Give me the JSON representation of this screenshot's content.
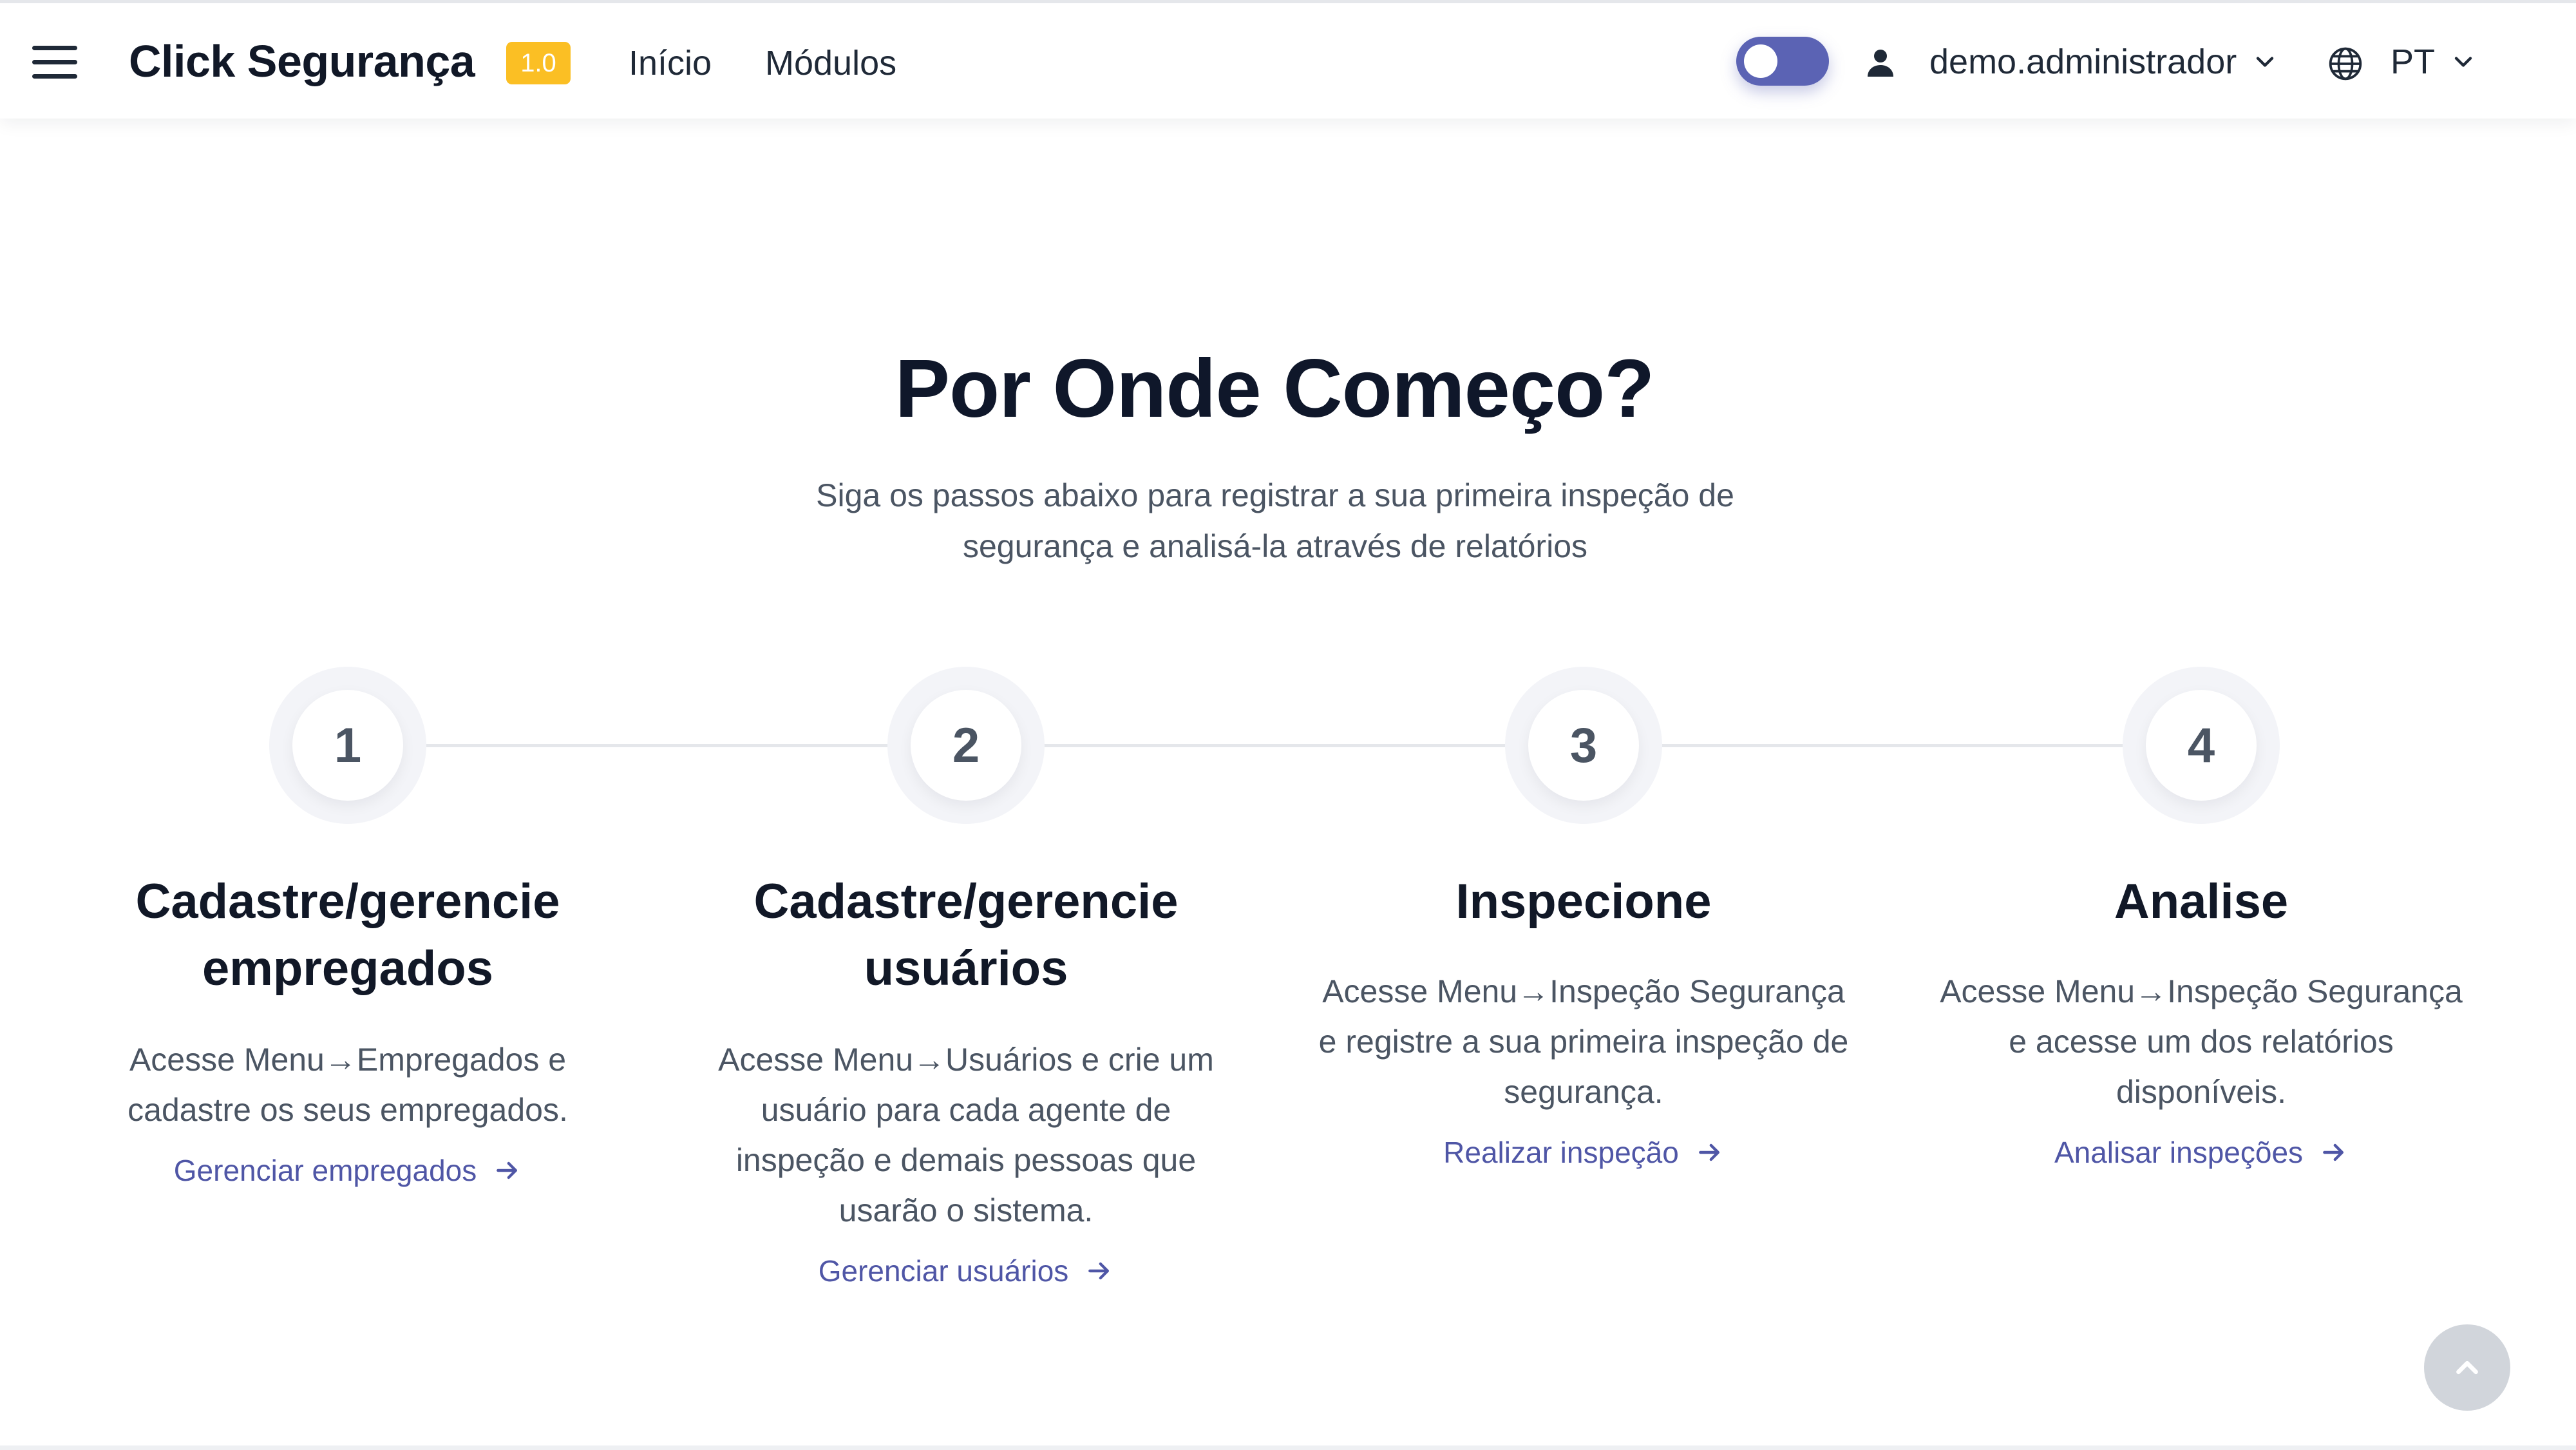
{
  "header": {
    "brand": "Click Segurança",
    "version": "1.0",
    "nav": {
      "inicio": "Início",
      "modulos": "Módulos"
    },
    "toggle_state": "off",
    "user": "demo.administrador",
    "language": "PT",
    "icons": {
      "menu": "hamburger-icon",
      "user": "user-icon",
      "language": "globe-icon",
      "dropdown": "chevron-down-icon"
    }
  },
  "hero": {
    "title": "Por Onde Começo?",
    "subtitle": "Siga os passos abaixo para registrar a sua primeira inspeção de segurança e analisá-la através de relatórios"
  },
  "steps": [
    {
      "number": "1",
      "title": "Cadastre/gerencie empregados",
      "description": "Acesse Menu→Empregados e cadastre os seus empregados.",
      "link": "Gerenciar empregados"
    },
    {
      "number": "2",
      "title": "Cadastre/gerencie usuários",
      "description": "Acesse Menu→Usuários e crie um usuário para cada agente de inspeção e demais pessoas que usarão o sistema.",
      "link": "Gerenciar usuários"
    },
    {
      "number": "3",
      "title": "Inspecione",
      "description": "Acesse Menu→Inspeção Segurança e registre a sua primeira inspeção de segurança.",
      "link": "Realizar inspeção"
    },
    {
      "number": "4",
      "title": "Analise",
      "description": "Acesse Menu→Inspeção Segurança e acesse um dos relatórios disponíveis.",
      "link": "Analisar inspeções"
    }
  ],
  "colors": {
    "accent": "#5b63b4",
    "link": "#4f56a6",
    "badge": "#fbbf24",
    "text_dark": "#111827",
    "text_muted": "#4b5563"
  }
}
